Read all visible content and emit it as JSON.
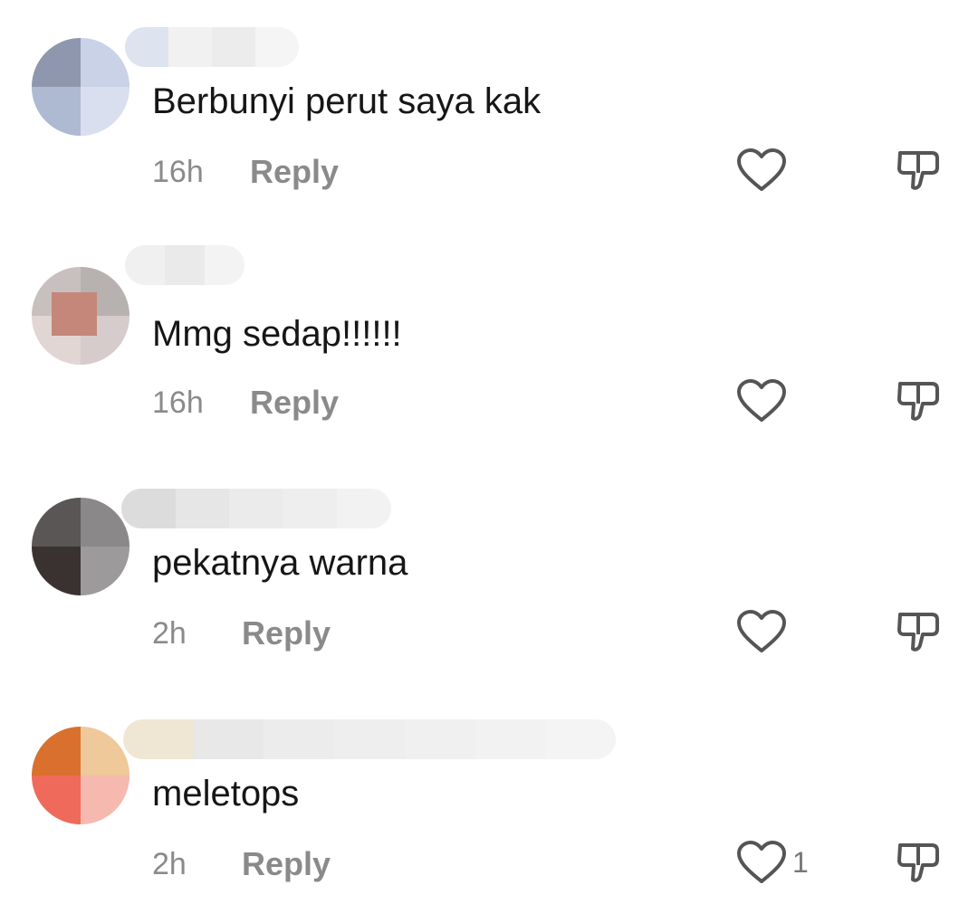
{
  "comments": [
    {
      "text": "Berbunyi perut saya kak",
      "time": "16h",
      "reply_label": "Reply",
      "like_count": "",
      "avatar_colors": [
        "#8e97ad",
        "#c9d2e6",
        "#aeb9d2",
        "#d9dfee"
      ],
      "username_colors": [
        "#e8ecf4",
        "#f2f2f2",
        "#eeeeee",
        "#f5f5f5"
      ]
    },
    {
      "text": "Mmg sedap!!!!!!",
      "time": "16h",
      "reply_label": "Reply",
      "like_count": "",
      "avatar_colors": [
        "#c8c0be",
        "#b7b2b0",
        "#e2d6d4",
        "#d6cccb"
      ],
      "username_colors": [
        "#f0f0f0",
        "#eaeaea",
        "#f3f3f3",
        "#f6f6f6"
      ]
    },
    {
      "text": "pekatnya warna",
      "time": "2h",
      "reply_label": "Reply",
      "like_count": "",
      "avatar_colors": [
        "#5a5656",
        "#8a8888",
        "#3a3230",
        "#9c9a9a"
      ],
      "username_colors": [
        "#dcdcdc",
        "#e6e6e6",
        "#ebebeb",
        "#eeeeee"
      ]
    },
    {
      "text": "meletops",
      "time": "2h",
      "reply_label": "Reply",
      "like_count": "1",
      "avatar_colors": [
        "#d9702e",
        "#efc99a",
        "#ef6a5a",
        "#f6b9b0"
      ],
      "username_colors": [
        "#e8e8e8",
        "#ececec",
        "#eeeeee",
        "#f2f2f2"
      ]
    }
  ],
  "icons": {
    "like": "heart-outline-icon",
    "dislike": "thumbs-down-icon"
  },
  "colors": {
    "text": "#161616",
    "meta": "#8a8a8a",
    "icon_stroke": "#555555"
  }
}
